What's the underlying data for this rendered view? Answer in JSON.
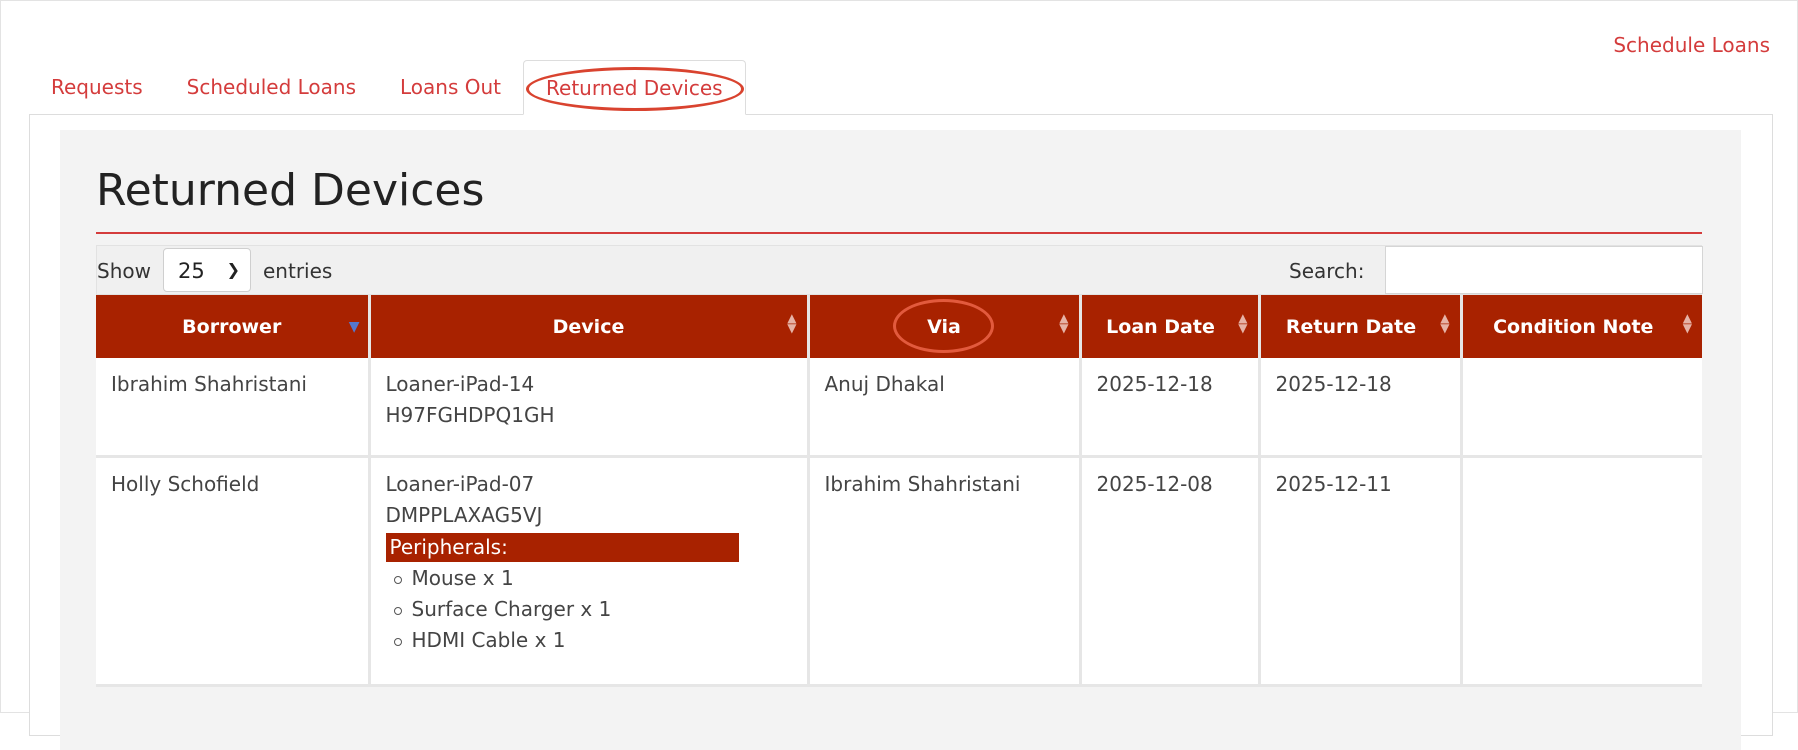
{
  "header": {
    "schedule_link": "Schedule Loans"
  },
  "tabs": [
    {
      "label": "Requests"
    },
    {
      "label": "Scheduled Loans"
    },
    {
      "label": "Loans Out"
    },
    {
      "label": "Returned Devices",
      "active": true
    }
  ],
  "page": {
    "title": "Returned Devices"
  },
  "controls": {
    "show_label": "Show",
    "entries_label": "entries",
    "length_value": "25",
    "search_label": "Search:",
    "search_value": ""
  },
  "table": {
    "columns": [
      "Borrower",
      "Device",
      "Via",
      "Loan Date",
      "Return Date",
      "Condition Note"
    ],
    "rows": [
      {
        "borrower": "Ibrahim Shahristani",
        "device_name": "Loaner-iPad-14",
        "device_serial": "H97FGHDPQ1GH",
        "via": "Anuj Dhakal",
        "loan_date": "2025-12-18",
        "return_date": "2025-12-18",
        "condition_note": ""
      },
      {
        "borrower": "Holly Schofield",
        "device_name": "Loaner-iPad-07",
        "device_serial": "DMPPLAXAG5VJ",
        "peripherals_label": "Peripherals:",
        "peripherals": [
          "Mouse x 1",
          "Surface Charger x 1",
          "HDMI Cable x 1"
        ],
        "via": "Ibrahim Shahristani",
        "loan_date": "2025-12-08",
        "return_date": "2025-12-11",
        "condition_note": ""
      }
    ]
  },
  "colors": {
    "accent": "#d43c3c",
    "header_bg": "#a82200",
    "annotation": "#d9432f"
  }
}
